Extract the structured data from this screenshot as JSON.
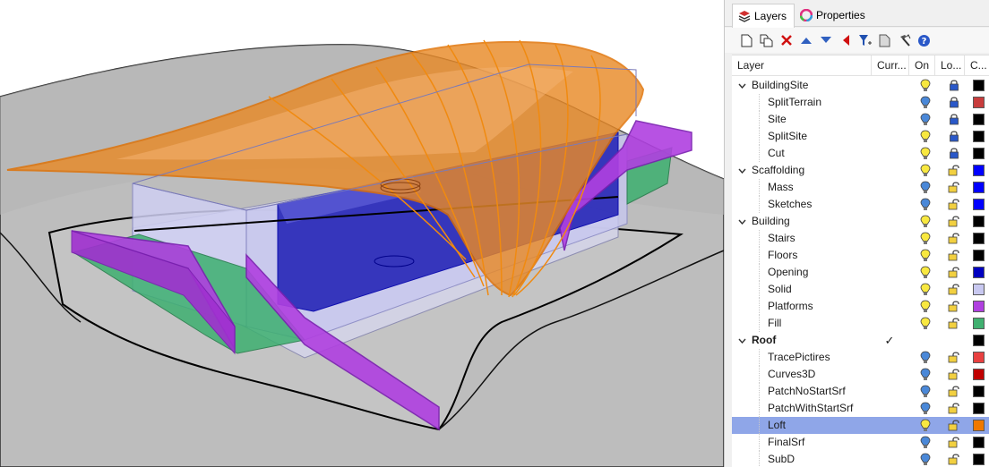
{
  "panel": {
    "tabs": [
      {
        "label": "Layers",
        "icon": "layers-icon",
        "active": true
      },
      {
        "label": "Properties",
        "icon": "properties-icon",
        "active": false
      }
    ],
    "toolbar": [
      {
        "name": "new-layer-button",
        "icon": "new-document-icon"
      },
      {
        "name": "new-sublayer-button",
        "icon": "copy-documents-icon"
      },
      {
        "name": "delete-layer-button",
        "icon": "red-x-icon"
      },
      {
        "name": "move-up-button",
        "icon": "triangle-up-icon"
      },
      {
        "name": "move-down-button",
        "icon": "triangle-down-icon"
      },
      {
        "name": "move-to-parent-button",
        "icon": "triangle-left-icon"
      },
      {
        "name": "filter-button",
        "icon": "filter-icon"
      },
      {
        "name": "layer-states-button",
        "icon": "document-icon"
      },
      {
        "name": "tools-button",
        "icon": "hammer-icon"
      },
      {
        "name": "help-button",
        "icon": "help-icon"
      }
    ],
    "headers": {
      "layer": "Layer",
      "current": "Curr...",
      "on": "On",
      "lock": "Lo...",
      "color": "C..."
    },
    "layers": [
      {
        "name": "BuildingSite",
        "level": 0,
        "expanded": true,
        "bulb": "on",
        "locked": true,
        "color": "#000000"
      },
      {
        "name": "SplitTerrain",
        "level": 1,
        "bulb": "off",
        "locked": true,
        "color": "#c83c3c"
      },
      {
        "name": "Site",
        "level": 1,
        "bulb": "off",
        "locked": true,
        "color": "#000000"
      },
      {
        "name": "SplitSite",
        "level": 1,
        "bulb": "on",
        "locked": true,
        "color": "#000000"
      },
      {
        "name": "Cut",
        "level": 1,
        "bulb": "on",
        "locked": true,
        "color": "#000000"
      },
      {
        "name": "Scaffolding",
        "level": 0,
        "expanded": true,
        "bulb": "on",
        "locked": false,
        "color": "#0000ff"
      },
      {
        "name": "Mass",
        "level": 1,
        "bulb": "off",
        "locked": false,
        "color": "#0000ff"
      },
      {
        "name": "Sketches",
        "level": 1,
        "bulb": "off",
        "locked": false,
        "color": "#0000ff"
      },
      {
        "name": "Building",
        "level": 0,
        "expanded": true,
        "bulb": "on",
        "locked": false,
        "color": "#000000"
      },
      {
        "name": "Stairs",
        "level": 1,
        "bulb": "on",
        "locked": false,
        "color": "#000000"
      },
      {
        "name": "Floors",
        "level": 1,
        "bulb": "on",
        "locked": false,
        "color": "#000000"
      },
      {
        "name": "Opening",
        "level": 1,
        "bulb": "on",
        "locked": false,
        "color": "#0000c0"
      },
      {
        "name": "Solid",
        "level": 1,
        "bulb": "on",
        "locked": false,
        "color": "#c8c8f0"
      },
      {
        "name": "Platforms",
        "level": 1,
        "bulb": "on",
        "locked": false,
        "color": "#b040e0"
      },
      {
        "name": "Fill",
        "level": 1,
        "bulb": "on",
        "locked": false,
        "color": "#40b070"
      },
      {
        "name": "Roof",
        "level": 0,
        "expanded": true,
        "bold": true,
        "current": true,
        "bulb": "none",
        "locked": null,
        "color": "#000000"
      },
      {
        "name": "TracePictires",
        "level": 1,
        "bulb": "off",
        "locked": false,
        "color": "#e84040"
      },
      {
        "name": "Curves3D",
        "level": 1,
        "bulb": "off",
        "locked": false,
        "color": "#c00000"
      },
      {
        "name": "PatchNoStartSrf",
        "level": 1,
        "bulb": "off",
        "locked": false,
        "color": "#000000"
      },
      {
        "name": "PatchWithStartSrf",
        "level": 1,
        "bulb": "off",
        "locked": false,
        "color": "#000000"
      },
      {
        "name": "Loft",
        "level": 1,
        "bulb": "on",
        "locked": false,
        "color": "#f07800",
        "selected": true
      },
      {
        "name": "FinalSrf",
        "level": 1,
        "bulb": "off",
        "locked": false,
        "color": "#000000"
      },
      {
        "name": "SubD",
        "level": 1,
        "bulb": "off",
        "locked": false,
        "color": "#000000"
      }
    ],
    "current_mark": "✓"
  }
}
